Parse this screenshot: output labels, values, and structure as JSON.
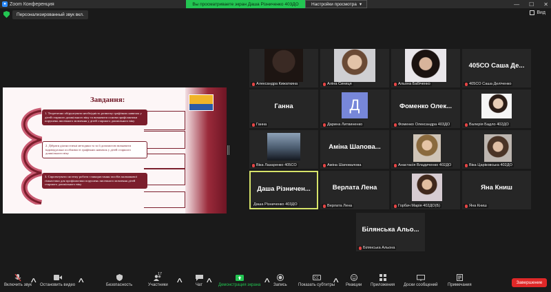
{
  "window": {
    "title": "Zoom Конференция",
    "min": "—",
    "max": "☐",
    "close": "✕"
  },
  "share_banner": "Вы просматриваете экран Даша Різниченко 403ДО",
  "view_options": {
    "label": "Настройки просмотра",
    "chevron": "▾"
  },
  "audio_pill": "Персонализированный звук вкл.",
  "view_button": "Вид",
  "slide": {
    "title": "Завдання:",
    "tasks": [
      "1. Теоретично обґрунтувати необхідність розвитку графічних навичок у дітей старшого дошкільного віку та визначити основи профілактики порушень писемного мовлення у дітей старшого дошкільного віку",
      "2. Дібрати діагностичні методики та за її допомогою визначити індивідуальні особливості графічних навичок у дітей старшого дошкільного віку",
      "3. Спроектувати систему роботи з використання засобів пальчикової гімнастики для профілактики порушень писемного мовлення дітей старшого дошкільного віку"
    ]
  },
  "participants": [
    {
      "caption": "Александра Кижаткина",
      "big": "",
      "muted": true,
      "kind": "photo"
    },
    {
      "caption": "Аліна Синиця",
      "big": "",
      "muted": true,
      "kind": "photo"
    },
    {
      "caption": "Альона Бабіченко",
      "big": "",
      "muted": true,
      "kind": "photo"
    },
    {
      "caption": "405СО Саша Деліченко",
      "big": "405СО Саша Де...",
      "muted": true,
      "kind": "name"
    },
    {
      "caption": "Ганна",
      "big": "Ганна",
      "muted": true,
      "kind": "name"
    },
    {
      "caption": "Дарина Литвиненко",
      "big": "",
      "muted": true,
      "kind": "avatar",
      "avatar_letter": "Д"
    },
    {
      "caption": "Фоменко Олександра 403ДО",
      "big": "Фоменко Олек...",
      "muted": true,
      "kind": "name"
    },
    {
      "caption": "Валерія Бадло 402ДО",
      "big": "",
      "muted": true,
      "kind": "photo"
    },
    {
      "caption": "Віка Лазаренко 405СО",
      "big": "",
      "muted": true,
      "kind": "photo"
    },
    {
      "caption": "Аміна Шаповалова",
      "big": "Аміна Шапова...",
      "muted": true,
      "kind": "name"
    },
    {
      "caption": "Анастасія Владиченко 402ДО",
      "big": "",
      "muted": true,
      "kind": "photo"
    },
    {
      "caption": "Віка Царіковська 402ДО",
      "big": "",
      "muted": true,
      "kind": "photo"
    },
    {
      "caption": "Даша Різниченко 403ДО",
      "big": "Даша Різничен...",
      "muted": false,
      "kind": "name"
    },
    {
      "caption": "Верлата Лена",
      "big": "Верлата Лена",
      "muted": true,
      "kind": "name"
    },
    {
      "caption": "Горбач Марія 402ДО(Б)",
      "big": "",
      "muted": true,
      "kind": "photo"
    },
    {
      "caption": "Яна Книш",
      "big": "Яна Книш",
      "muted": true,
      "kind": "name"
    },
    {
      "caption": "Білянська Альона",
      "big": "Білянська Альо...",
      "muted": true,
      "kind": "name"
    }
  ],
  "toolbar": {
    "unmute": "Включить звук",
    "stop_video": "Остановить видео",
    "security": "Безопасность",
    "participants": "Участники",
    "participants_count": "17",
    "chat": "Чат",
    "share": "Демонстрация экрана",
    "record": "Запись",
    "captions": "Показать субтитры",
    "reactions": "Реакции",
    "apps": "Приложения",
    "whiteboards": "Доски сообщений",
    "notes": "Примечания",
    "end": "Завершение"
  },
  "colors": {
    "share_green": "#23c552",
    "end_red": "#e02828",
    "slide_maroon": "#7b1e2c",
    "active_tile": "#d7e46a"
  }
}
